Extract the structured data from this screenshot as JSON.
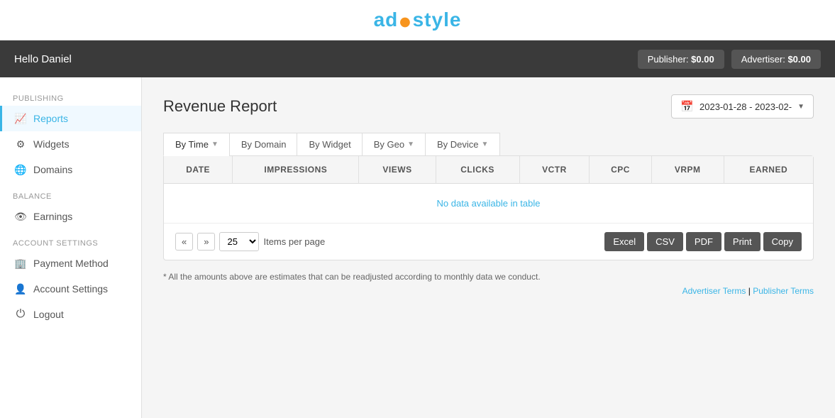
{
  "logo": {
    "text_before": "ad",
    "dot": "✦",
    "text_after": "style"
  },
  "header": {
    "greeting": "Hello Daniel",
    "publisher_label": "Publisher:",
    "publisher_amount": "$0.00",
    "advertiser_label": "Advertiser:",
    "advertiser_amount": "$0.00"
  },
  "sidebar": {
    "publishing_label": "Publishing",
    "items_publishing": [
      {
        "id": "reports",
        "label": "Reports",
        "icon": "📈",
        "active": true
      },
      {
        "id": "widgets",
        "label": "Widgets",
        "icon": "⚙"
      },
      {
        "id": "domains",
        "label": "Domains",
        "icon": "🌐"
      }
    ],
    "balance_label": "Balance",
    "items_balance": [
      {
        "id": "earnings",
        "label": "Earnings",
        "icon": "👁"
      }
    ],
    "account_label": "Account Settings",
    "items_account": [
      {
        "id": "payment",
        "label": "Payment Method",
        "icon": "🏦"
      },
      {
        "id": "account-settings",
        "label": "Account Settings",
        "icon": "👤"
      },
      {
        "id": "logout",
        "label": "Logout",
        "icon": "⏻"
      }
    ]
  },
  "main": {
    "page_title": "Revenue Report",
    "date_range": "2023-01-28 - 2023-02-",
    "tabs": [
      {
        "id": "by-time",
        "label": "By Time",
        "has_arrow": true,
        "active": true
      },
      {
        "id": "by-domain",
        "label": "By Domain",
        "has_arrow": false
      },
      {
        "id": "by-widget",
        "label": "By Widget",
        "has_arrow": false
      },
      {
        "id": "by-geo",
        "label": "By Geo",
        "has_arrow": true
      },
      {
        "id": "by-device",
        "label": "By Device",
        "has_arrow": true
      }
    ],
    "table": {
      "columns": [
        "DATE",
        "IMPRESSIONS",
        "VIEWS",
        "CLICKS",
        "VCTR",
        "CPC",
        "VRPM",
        "EARNED"
      ],
      "no_data_message": "No data available in table"
    },
    "pagination": {
      "prev": "«",
      "next": "»",
      "per_page": "25",
      "per_page_label": "Items per page"
    },
    "export_buttons": [
      "Excel",
      "CSV",
      "PDF",
      "Print",
      "Copy"
    ],
    "footer_note": "* All the amounts above are estimates that can be readjusted according to monthly data we conduct.",
    "footer_links": {
      "advertiser": "Advertiser Terms",
      "separator": " | ",
      "publisher": "Publisher Terms"
    }
  }
}
